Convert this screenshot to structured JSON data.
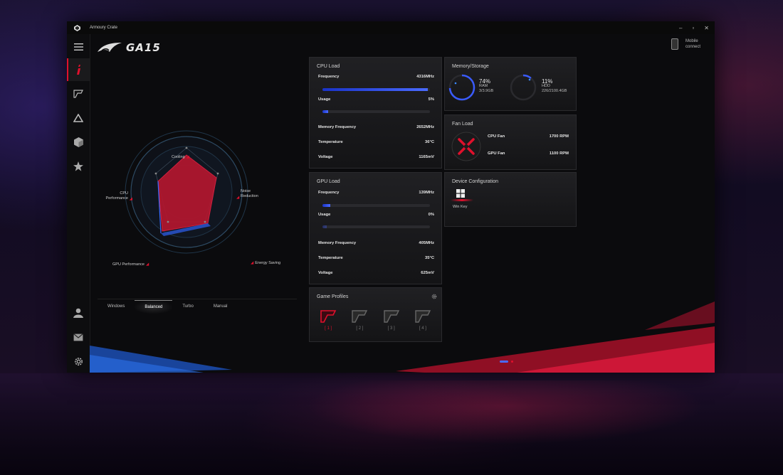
{
  "window": {
    "title": "Armoury Crate",
    "minimize": "–",
    "maximize": "▫",
    "close": "✕"
  },
  "header": {
    "model": "GA15",
    "mobile_label": "Mobile\nconnect"
  },
  "radar": {
    "labels": {
      "cooling": "Cooling",
      "noise": "Noise\nReduction",
      "energy": "Energy Saving",
      "gpu": "GPU Performance",
      "cpu": "CPU\nPerformance"
    }
  },
  "modes": [
    "Windows",
    "Balanced",
    "Turbo",
    "Manual"
  ],
  "active_mode": "Balanced",
  "cpu": {
    "title": "CPU Load",
    "frequency_label": "Frequency",
    "frequency": "4316MHz",
    "frequency_level": 0.98,
    "usage_label": "Usage",
    "usage": "5%",
    "usage_level": 0.05,
    "mem_freq_label": "Memory Frequency",
    "mem_freq": "2652MHz",
    "temp_label": "Temperature",
    "temp": "36°C",
    "volt_label": "Voltage",
    "volt": "1165mV"
  },
  "gpu": {
    "title": "GPU Load",
    "frequency_label": "Frequency",
    "frequency": "139MHz",
    "frequency_level": 0.07,
    "usage_label": "Usage",
    "usage": "0%",
    "usage_level": 0.0,
    "mem_freq_label": "Memory Frequency",
    "mem_freq": "405MHz",
    "temp_label": "Temperature",
    "temp": "35°C",
    "volt_label": "Voltage",
    "volt": "625mV"
  },
  "memory": {
    "title": "Memory/Storage",
    "ram_pct": "74%",
    "ram_label": "RAM",
    "ram_detail": "3/3.9GB",
    "ram_level": 0.74,
    "hdd_pct": "11%",
    "hdd_label": "HDD",
    "hdd_detail": "226/2100.4GB",
    "hdd_level": 0.11
  },
  "fan": {
    "title": "Fan Load",
    "cpu_label": "CPU Fan",
    "cpu_rpm": "1700 RPM",
    "gpu_label": "GPU Fan",
    "gpu_rpm": "1100 RPM"
  },
  "device": {
    "title": "Device Configuration",
    "win_key_label": "Win Key"
  },
  "profiles": {
    "title": "Game Profiles",
    "items": [
      "[ 1 ]",
      "[ 2 ]",
      "[ 3 ]",
      "[ 4 ]"
    ]
  },
  "colors": {
    "accent": "#e0102c",
    "blue": "#3a5bff"
  },
  "icons": [
    "menu-icon",
    "info-icon",
    "gamevisual-icon",
    "aura-icon",
    "box-icon",
    "star-icon",
    "user-icon",
    "mail-icon",
    "gear-icon"
  ]
}
